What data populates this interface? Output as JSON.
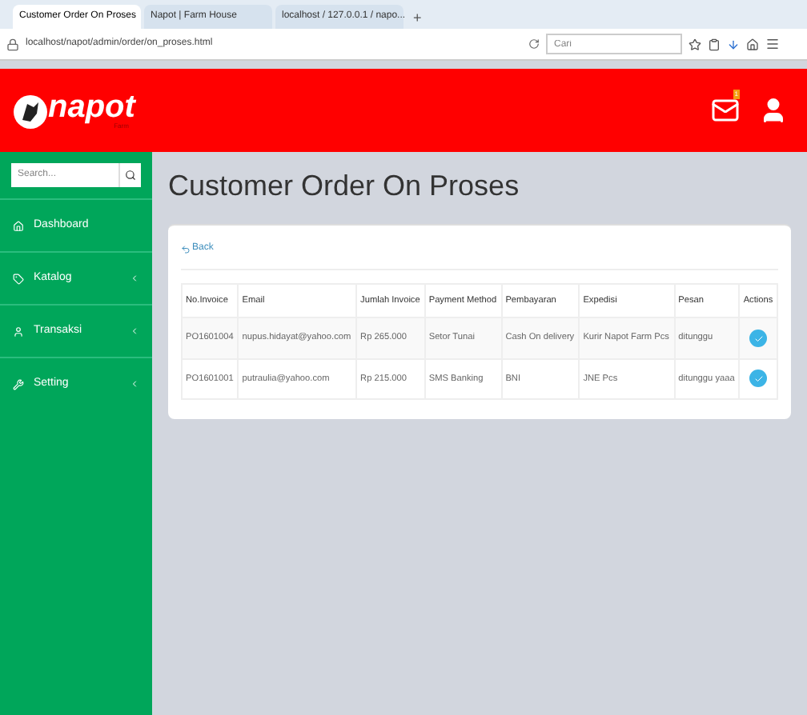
{
  "browser": {
    "tabs": [
      {
        "label": "Customer Order On Proses",
        "selected": true
      },
      {
        "label": "Napot | Farm House",
        "selected": false
      },
      {
        "label": "localhost / 127.0.0.1 / napo...",
        "selected": false
      }
    ],
    "new_tab": "+",
    "url": "localhost/napot/admin/order/on_proses.html",
    "search_placeholder": "Cari"
  },
  "header": {
    "logo": "napot",
    "logo_sub": "Farm",
    "mail_badge": "1"
  },
  "sidebar": {
    "search_placeholder": "Search...",
    "items": [
      {
        "label": "Dashboard",
        "has_submenu": false
      },
      {
        "label": "Katalog",
        "has_submenu": true
      },
      {
        "label": "Transaksi",
        "has_submenu": true
      },
      {
        "label": "Setting",
        "has_submenu": true
      }
    ]
  },
  "page_title": "Customer Order On Proses",
  "back": "Back",
  "table": {
    "columns": [
      "No.Invoice",
      "Email",
      "Jumlah Invoice",
      "Payment Method",
      "Pembayaran",
      "Expedisi",
      "Pesan",
      "Actions"
    ],
    "rows": [
      {
        "cells": [
          "PO1601004",
          "nupus.hidayat@yahoo.com",
          "Rp 265.000",
          "Setor Tunai",
          "Cash On delivery",
          "Kurir Napot Farm Pcs",
          "ditunggu"
        ]
      },
      {
        "cells": [
          "PO1601001",
          "putraulia@yahoo.com",
          "Rp 215.000",
          "SMS Banking",
          "BNI",
          "JNE Pcs",
          "ditunggu yaaa"
        ]
      }
    ]
  }
}
